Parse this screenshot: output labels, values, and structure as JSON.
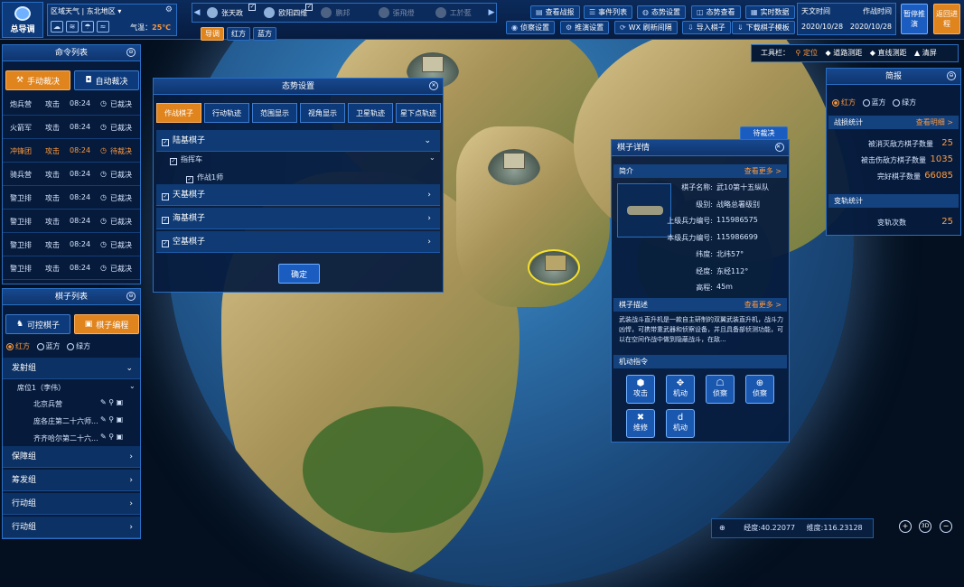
{
  "app": {
    "title": "总导调"
  },
  "weather": {
    "label": "区域天气",
    "region": "东北地区",
    "temp_label": "气温：",
    "temp": "25℃"
  },
  "players": [
    {
      "name": "张天政",
      "active": true,
      "checked": true
    },
    {
      "name": "欧阳四维",
      "active": true,
      "checked": true
    },
    {
      "name": "鹏邦",
      "active": false
    },
    {
      "name": "張飛燈",
      "active": false
    },
    {
      "name": "工於藍",
      "active": false
    }
  ],
  "subtabs": [
    "导调",
    "红方",
    "蓝方"
  ],
  "toolbar": {
    "row1": [
      "查看战报",
      "事件列表",
      "态势设置",
      "态势查看",
      "实时数据"
    ],
    "row2": [
      "侦察设置",
      "推演设置",
      "WX 刷新间隔",
      "导入棋子",
      "下载棋子模板"
    ]
  },
  "time": {
    "sky_label": "天文时间",
    "sky_date": "2020/10/28",
    "op_label": "作战时间",
    "op_date": "2020/10/28"
  },
  "big_buttons": {
    "pause": "暂停推演",
    "back": "返回进程"
  },
  "tools": {
    "label": "工具栏：",
    "items": [
      "定位",
      "道路测距",
      "直线测距",
      "清屏"
    ]
  },
  "commands": {
    "title": "命令列表",
    "tab_manual": "手动裁决",
    "tab_auto": "自动裁决",
    "rows": [
      {
        "unit": "炮兵营",
        "action": "攻击",
        "time": "08:24",
        "status": "已裁决",
        "pending": false
      },
      {
        "unit": "火箭军",
        "action": "攻击",
        "time": "08:24",
        "status": "已裁决",
        "pending": false
      },
      {
        "unit": "冲锋团",
        "action": "攻击",
        "time": "08:24",
        "status": "待裁决",
        "pending": true
      },
      {
        "unit": "骑兵营",
        "action": "攻击",
        "time": "08:24",
        "status": "已裁决",
        "pending": false
      },
      {
        "unit": "警卫排",
        "action": "攻击",
        "time": "08:24",
        "status": "已裁决",
        "pending": false
      },
      {
        "unit": "警卫排",
        "action": "攻击",
        "time": "08:24",
        "status": "已裁决",
        "pending": false
      },
      {
        "unit": "警卫排",
        "action": "攻击",
        "time": "08:24",
        "status": "已裁决",
        "pending": false
      },
      {
        "unit": "警卫排",
        "action": "攻击",
        "time": "08:24",
        "status": "已裁决",
        "pending": false
      }
    ]
  },
  "pieces": {
    "title": "棋子列表",
    "tab_control": "可控棋子",
    "tab_program": "棋子编程",
    "sides": [
      "红方",
      "蓝方",
      "绿方"
    ],
    "groups": [
      {
        "name": "发射组",
        "expanded": true
      },
      {
        "name": "保障组"
      },
      {
        "name": "筹发组"
      },
      {
        "name": "行动组"
      },
      {
        "name": "行动组"
      }
    ],
    "seat": "席位1（李伟）",
    "children": [
      "北京兵营",
      "庞各庄第二十六师...",
      "齐齐哈尔第二十六..."
    ]
  },
  "situation": {
    "title": "态势设置",
    "tabs": [
      "作战棋子",
      "行动轨迹",
      "范围显示",
      "视角显示",
      "卫星轨迹",
      "星下点轨迹"
    ],
    "rows": [
      "陆基棋子",
      "天基棋子",
      "海基棋子",
      "空基棋子"
    ],
    "sub": "指挥车",
    "subsub": "作战1师",
    "confirm": "确定"
  },
  "detail": {
    "badge": "待裁决",
    "title": "棋子详情",
    "intro": "简介",
    "more": "查看更多 >",
    "fields": [
      {
        "k": "棋子名称:",
        "v": "武10第十五纵队"
      },
      {
        "k": "级别:",
        "v": "战略总署级别"
      },
      {
        "k": "上级兵力编号:",
        "v": "115986575"
      },
      {
        "k": "本级兵力编号:",
        "v": "115986699"
      },
      {
        "k": "纬度:",
        "v": "北纬57°"
      },
      {
        "k": "经度:",
        "v": "东经112°"
      },
      {
        "k": "高程:",
        "v": "45m"
      }
    ],
    "desc_title": "棋子描述",
    "desc": "武装战斗直升机是一款自主研制的双翼武装直升机，战斗力凶悍，可携带重武器和侦察设备，并且具备部侦测功能，可以在空间作战中做到隐蔽战斗，在敌...",
    "orders_title": "机动指令",
    "orders": [
      "攻击",
      "机动",
      "侦察",
      "侦察",
      "维修",
      "机动"
    ]
  },
  "brief": {
    "title": "简报",
    "sides": [
      "红方",
      "蓝方",
      "绿方"
    ],
    "stats_label": "战损统计",
    "detail_link": "查看明细 >",
    "stats": [
      {
        "k": "被消灭敌方棋子数量",
        "v": "25"
      },
      {
        "k": "被击伤敌方棋子数量",
        "v": "1035"
      },
      {
        "k": "完好棋子数量",
        "v": "66085"
      }
    ],
    "change_label": "变轨统计",
    "change": {
      "k": "变轨次数",
      "v": "25"
    }
  },
  "coords": {
    "lon": "经度:40.22077",
    "lat": "维度:116.23128"
  },
  "colors": {
    "accent": "#e0841e",
    "panel": "#061c3e",
    "border": "#2a6ec2",
    "highlight": "#ff9a3c"
  }
}
